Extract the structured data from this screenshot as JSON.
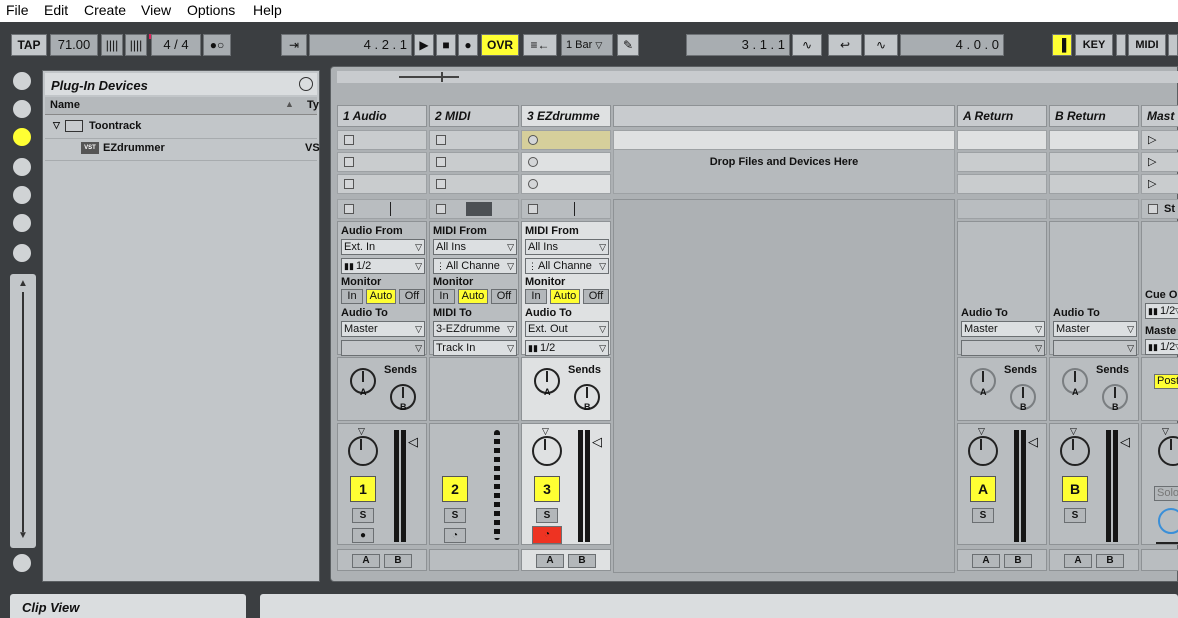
{
  "menu": [
    "File",
    "Edit",
    "Create",
    "View",
    "Options",
    "Help"
  ],
  "transport": {
    "tap": "TAP",
    "tempo": "71.00",
    "time_sig": "4 / 4",
    "metro": "●○",
    "follow": "⇥",
    "position": "4 .   2 .   1",
    "ovr": "OVR",
    "quant": "1 Bar",
    "loop_start": "3 .   1 .   1",
    "loop_len": "4 .   0 .   0",
    "key": "KEY",
    "midi": "MIDI"
  },
  "browser": {
    "title": "Plug-In Devices",
    "col_name": "Name",
    "col_type": "Ty",
    "rows": [
      {
        "label": "Toontrack",
        "type": ""
      },
      {
        "label": "EZdrummer",
        "type": "VS"
      }
    ]
  },
  "session": {
    "drop_text": "Drop Files and Devices Here",
    "tracks": [
      {
        "name": "1 Audio",
        "from_label": "Audio From",
        "from": "Ext. In",
        "chan": "1/2",
        "to_label": "Audio To",
        "to": "Master",
        "to2": "",
        "num": "1"
      },
      {
        "name": "2 MIDI",
        "from_label": "MIDI From",
        "from": "All Ins",
        "chan": "All Channe",
        "to_label": "MIDI To",
        "to": "3-EZdrumme",
        "to2": "Track In",
        "num": "2"
      },
      {
        "name": "3 EZdrumme",
        "from_label": "MIDI From",
        "from": "All Ins",
        "chan": "All Channe",
        "to_label": "Audio To",
        "to": "Ext. Out",
        "to2": "1/2",
        "num": "3"
      }
    ],
    "returns": [
      {
        "name": "A Return",
        "to_label": "Audio To",
        "to": "Master",
        "num": "A"
      },
      {
        "name": "B Return",
        "to_label": "Audio To",
        "to": "Master",
        "num": "B"
      }
    ],
    "master": {
      "name": "Mast",
      "cue_label": "Cue O",
      "cue": "1/2",
      "master_label": "Maste",
      "master_out": "1/2",
      "post": "Post",
      "solo": "Solo",
      "stop": "St"
    },
    "monitor_label": "Monitor",
    "mon_in": "In",
    "mon_auto": "Auto",
    "mon_off": "Off",
    "sends": "Sends",
    "knob_a": "A",
    "knob_b": "B",
    "solo_btn": "S",
    "ab_a": "A",
    "ab_b": "B"
  },
  "clip_view": "Clip View",
  "colors": {
    "accent": "#ffff33",
    "record": "#ee3322",
    "panel": "#adb1b4"
  }
}
